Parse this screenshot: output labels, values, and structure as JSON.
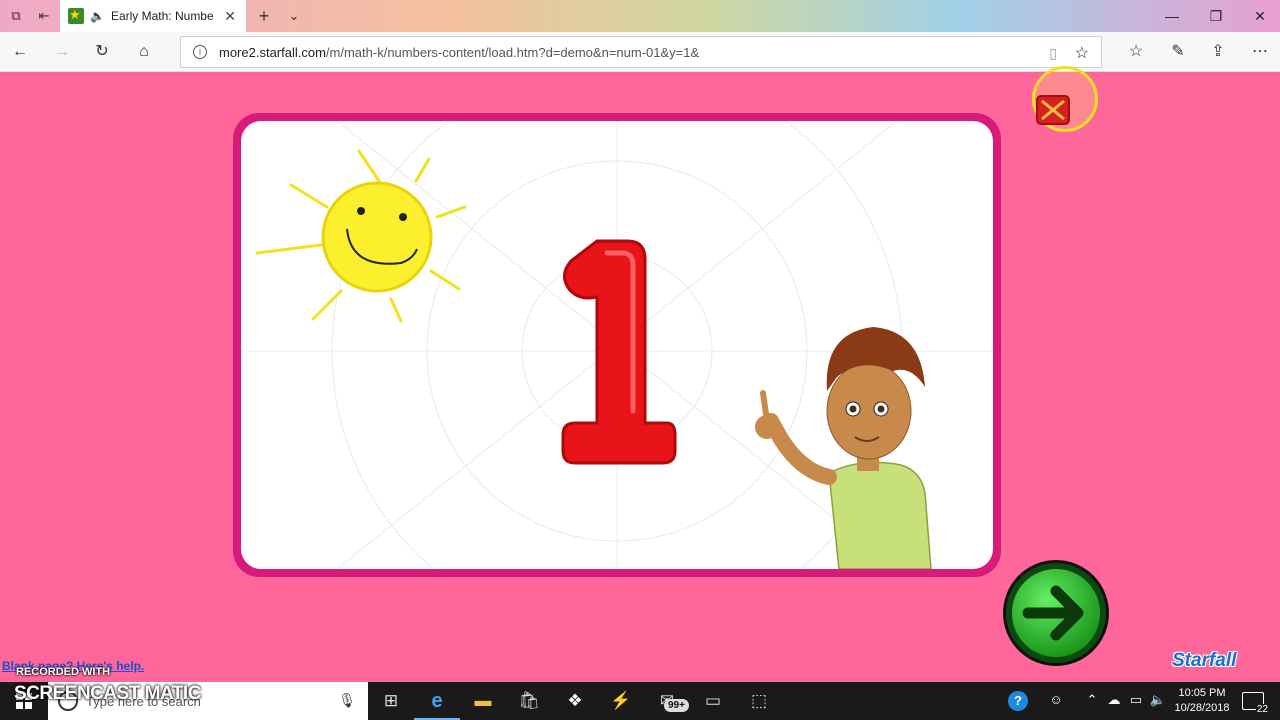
{
  "browser": {
    "tab_title": "Early Math: Numbe",
    "url_host": "more2.starfall.com",
    "url_path": "/m/math-k/numbers-content/load.htm?d=demo&n=num-01&y=1&"
  },
  "lesson": {
    "numeral": "1"
  },
  "branding": {
    "logo_text": "Starfall"
  },
  "overlay": {
    "help_link": "Blank page? Here's help.",
    "recorded_with": "RECORDED WITH",
    "watermark": "SCREENCAST MATIC"
  },
  "taskbar": {
    "search_placeholder": "Type here to search",
    "store_badge": "99+",
    "time": "10:05 PM",
    "date": "10/28/2018",
    "notification_count": "22"
  },
  "colors": {
    "page_bg": "#ff6699",
    "card_border": "#d81b7a",
    "numeral_red": "#e8141a",
    "next_green": "#2bd02b"
  }
}
